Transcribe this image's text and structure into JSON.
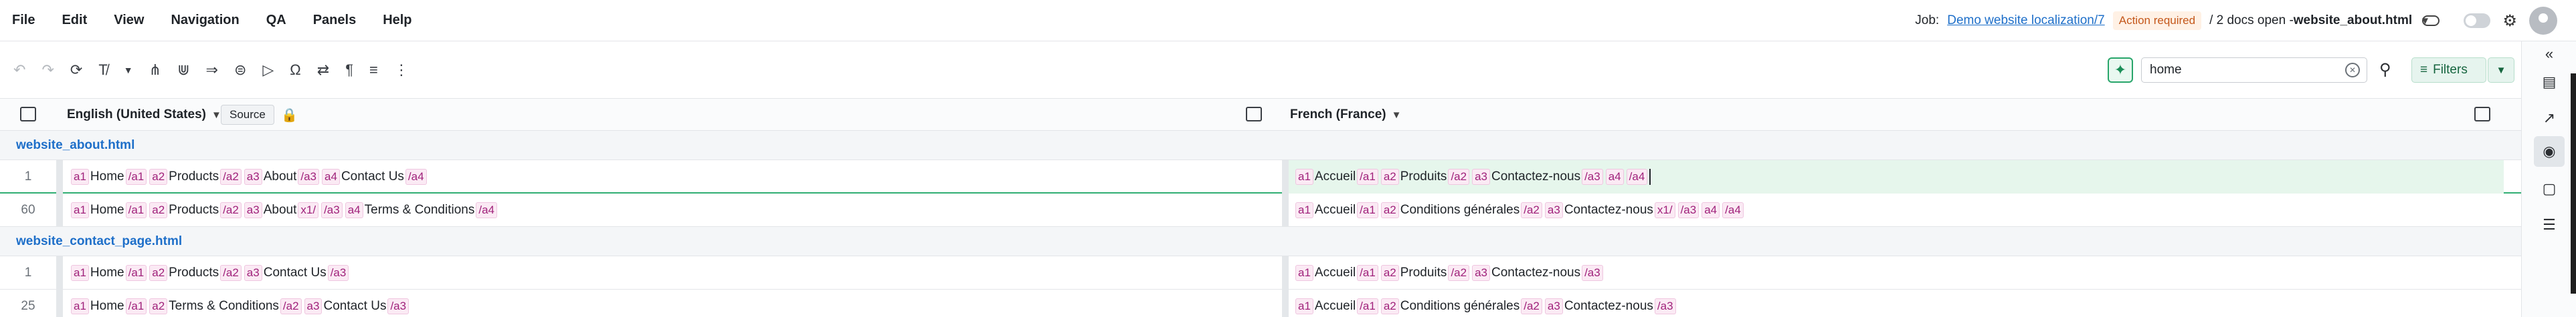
{
  "menu": [
    "File",
    "Edit",
    "View",
    "Navigation",
    "QA",
    "Panels",
    "Help"
  ],
  "job": {
    "label": "Job:",
    "link": "Demo website localization/7",
    "badge": "Action required",
    "docs_prefix": "/ 2 docs open -",
    "docs_file": "website_about.html"
  },
  "colors": {
    "accent": "#1e6fc9",
    "tag": "#a0227b",
    "selected": "#e6f6ec",
    "badge": "#c4571a"
  },
  "toolbar": {
    "icons": [
      "undo-icon",
      "redo-icon",
      "refresh-icon",
      "clear-format-icon",
      "chevron-down-icon",
      "merge-icon",
      "split-icon",
      "copy-source-icon",
      "insert-tag-icon",
      "label-icon",
      "special-char-icon",
      "translate-icon",
      "pilcrow-icon",
      "format-icon",
      "more-icon"
    ],
    "search_value": "home",
    "filters_label": "Filters"
  },
  "source_header": {
    "language": "English (United States)",
    "source_label": "Source"
  },
  "target_header": {
    "language": "French (France)"
  },
  "files": [
    {
      "name": "website_about.html",
      "rows": [
        {
          "num": "1",
          "source": [
            {
              "t": "tag",
              "v": "a1"
            },
            {
              "t": "txt",
              "v": "Home"
            },
            {
              "t": "tag",
              "v": "/a1"
            },
            {
              "t": "tag",
              "v": "a2"
            },
            {
              "t": "txt",
              "v": "Products"
            },
            {
              "t": "tag",
              "v": "/a2"
            },
            {
              "t": "tag",
              "v": "a3"
            },
            {
              "t": "txt",
              "v": "About"
            },
            {
              "t": "tag",
              "v": "/a3"
            },
            {
              "t": "tag",
              "v": "a4"
            },
            {
              "t": "txt",
              "v": "Contact Us"
            },
            {
              "t": "tag",
              "v": "/a4"
            }
          ],
          "target": [
            {
              "t": "tag",
              "v": "a1"
            },
            {
              "t": "txt",
              "v": "Accueil"
            },
            {
              "t": "tag",
              "v": "/a1"
            },
            {
              "t": "tag",
              "v": "a2"
            },
            {
              "t": "txt",
              "v": "Produits"
            },
            {
              "t": "tag",
              "v": "/a2"
            },
            {
              "t": "tag",
              "v": "a3"
            },
            {
              "t": "txt",
              "v": "Contactez-nous"
            },
            {
              "t": "tag",
              "v": "/a3"
            },
            {
              "t": "tag",
              "v": "a4"
            },
            {
              "t": "tag",
              "v": "/a4"
            }
          ]
        },
        {
          "num": "60",
          "source": [
            {
              "t": "tag",
              "v": "a1"
            },
            {
              "t": "txt",
              "v": "Home"
            },
            {
              "t": "tag",
              "v": "/a1"
            },
            {
              "t": "tag",
              "v": "a2"
            },
            {
              "t": "txt",
              "v": "Products"
            },
            {
              "t": "tag",
              "v": "/a2"
            },
            {
              "t": "tag",
              "v": "a3"
            },
            {
              "t": "txt",
              "v": "About"
            },
            {
              "t": "tag",
              "v": "x1/"
            },
            {
              "t": "tag",
              "v": "/a3"
            },
            {
              "t": "tag",
              "v": "a4"
            },
            {
              "t": "txt",
              "v": "Terms & Conditions"
            },
            {
              "t": "tag",
              "v": "/a4"
            }
          ],
          "target": [
            {
              "t": "tag",
              "v": "a1"
            },
            {
              "t": "txt",
              "v": "Accueil"
            },
            {
              "t": "tag",
              "v": "/a1"
            },
            {
              "t": "tag",
              "v": "a2"
            },
            {
              "t": "txt",
              "v": "Conditions générales"
            },
            {
              "t": "tag",
              "v": "/a2"
            },
            {
              "t": "tag",
              "v": "a3"
            },
            {
              "t": "txt",
              "v": "Contactez-nous"
            },
            {
              "t": "tag",
              "v": "x1/"
            },
            {
              "t": "tag",
              "v": "/a3"
            },
            {
              "t": "tag",
              "v": "a4"
            },
            {
              "t": "tag",
              "v": "/a4"
            }
          ]
        }
      ]
    },
    {
      "name": "website_contact_page.html",
      "rows": [
        {
          "num": "1",
          "source": [
            {
              "t": "tag",
              "v": "a1"
            },
            {
              "t": "txt",
              "v": "Home"
            },
            {
              "t": "tag",
              "v": "/a1"
            },
            {
              "t": "tag",
              "v": "a2"
            },
            {
              "t": "txt",
              "v": "Products"
            },
            {
              "t": "tag",
              "v": "/a2"
            },
            {
              "t": "tag",
              "v": "a3"
            },
            {
              "t": "txt",
              "v": "Contact Us"
            },
            {
              "t": "tag",
              "v": "/a3"
            }
          ],
          "target": [
            {
              "t": "tag",
              "v": "a1"
            },
            {
              "t": "txt",
              "v": "Accueil"
            },
            {
              "t": "tag",
              "v": "/a1"
            },
            {
              "t": "tag",
              "v": "a2"
            },
            {
              "t": "txt",
              "v": "Produits"
            },
            {
              "t": "tag",
              "v": "/a2"
            },
            {
              "t": "tag",
              "v": "a3"
            },
            {
              "t": "txt",
              "v": "Contactez-nous"
            },
            {
              "t": "tag",
              "v": "/a3"
            }
          ]
        },
        {
          "num": "25",
          "source": [
            {
              "t": "tag",
              "v": "a1"
            },
            {
              "t": "txt",
              "v": "Home"
            },
            {
              "t": "tag",
              "v": "/a1"
            },
            {
              "t": "tag",
              "v": "a2"
            },
            {
              "t": "txt",
              "v": "Terms & Conditions"
            },
            {
              "t": "tag",
              "v": "/a2"
            },
            {
              "t": "tag",
              "v": "a3"
            },
            {
              "t": "txt",
              "v": "Contact Us"
            },
            {
              "t": "tag",
              "v": "/a3"
            }
          ],
          "target": [
            {
              "t": "tag",
              "v": "a1"
            },
            {
              "t": "txt",
              "v": "Accueil"
            },
            {
              "t": "tag",
              "v": "/a1"
            },
            {
              "t": "tag",
              "v": "a2"
            },
            {
              "t": "txt",
              "v": "Conditions générales"
            },
            {
              "t": "tag",
              "v": "/a2"
            },
            {
              "t": "tag",
              "v": "a3"
            },
            {
              "t": "txt",
              "v": "Contactez-nous"
            },
            {
              "t": "tag",
              "v": "/a3"
            }
          ]
        }
      ]
    }
  ],
  "right_panel_icons": [
    "collapse-icon",
    "notes-icon",
    "chart-icon",
    "qa-icon",
    "comments-icon",
    "checklist-icon"
  ]
}
